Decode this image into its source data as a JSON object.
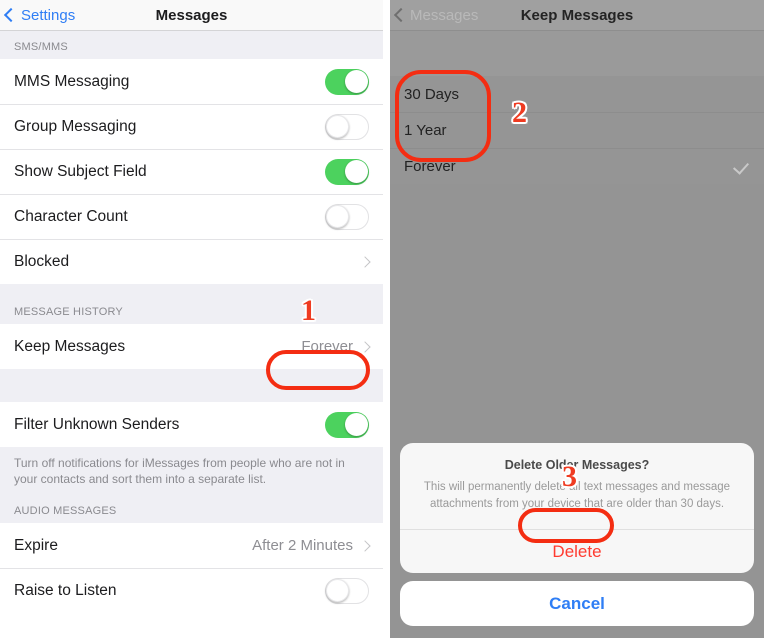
{
  "left_screen": {
    "nav": {
      "back_label": "Settings",
      "title": "Messages"
    },
    "sections": [
      {
        "header": "SMS/MMS",
        "rows": [
          {
            "label": "MMS Messaging",
            "type": "toggle",
            "value": "on"
          },
          {
            "label": "Group Messaging",
            "type": "toggle",
            "value": "off"
          },
          {
            "label": "Show Subject Field",
            "type": "toggle",
            "value": "on"
          },
          {
            "label": "Character Count",
            "type": "toggle",
            "value": "off"
          },
          {
            "label": "Blocked",
            "type": "disclosure",
            "value": ""
          }
        ]
      },
      {
        "header": "MESSAGE HISTORY",
        "rows": [
          {
            "label": "Keep Messages",
            "type": "disclosure",
            "value": "Forever"
          }
        ]
      },
      {
        "header": "",
        "rows": [
          {
            "label": "Filter Unknown Senders",
            "type": "toggle",
            "value": "on"
          }
        ],
        "footnote": "Turn off notifications for iMessages from people who are not in your contacts and sort them into a separate list."
      },
      {
        "header": "AUDIO MESSAGES",
        "rows": [
          {
            "label": "Expire",
            "type": "disclosure",
            "value": "After 2 Minutes"
          },
          {
            "label": "Raise to Listen",
            "type": "toggle",
            "value": "off"
          }
        ]
      }
    ]
  },
  "right_screen": {
    "nav": {
      "back_label": "Messages",
      "title": "Keep Messages"
    },
    "options": [
      {
        "label": "30 Days",
        "selected": false
      },
      {
        "label": "1 Year",
        "selected": false
      },
      {
        "label": "Forever",
        "selected": true
      }
    ],
    "alert": {
      "title": "Delete Older Messages?",
      "message": "This will permanently delete all text messages and message attachments from your device that are older than 30 days.",
      "confirm_label": "Delete",
      "cancel_label": "Cancel"
    }
  },
  "annotations": {
    "markers": [
      {
        "number": "1"
      },
      {
        "number": "2"
      },
      {
        "number": "3"
      }
    ],
    "highlight_color": "#f42d12"
  }
}
